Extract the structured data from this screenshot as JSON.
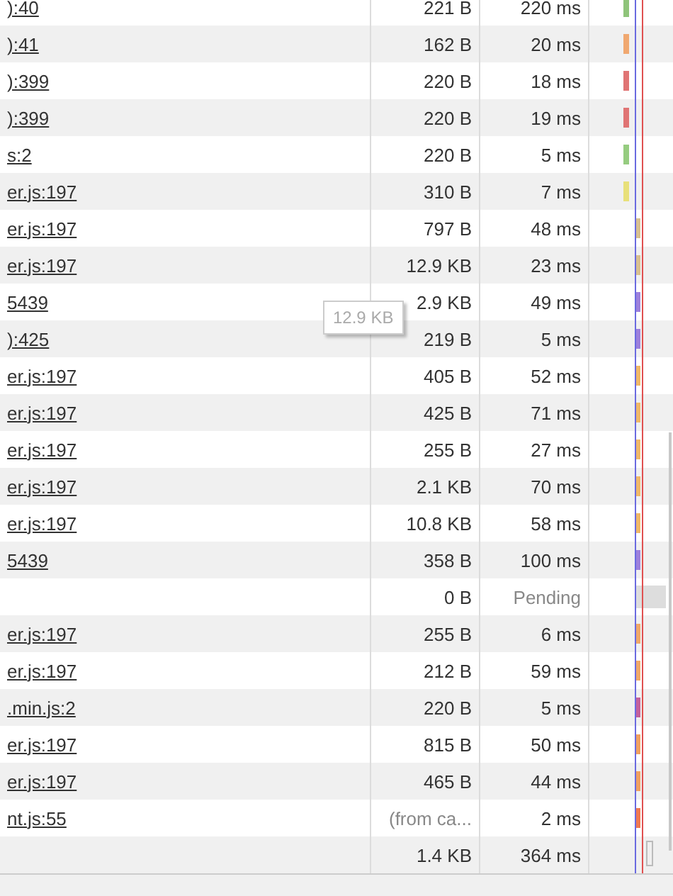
{
  "requests": [
    {
      "initiator": "):40",
      "size": "221 B",
      "time": "220 ms",
      "bar": {
        "kind": "early",
        "color": "#8fc47a"
      }
    },
    {
      "initiator": "):41",
      "size": "162 B",
      "time": "20 ms",
      "bar": {
        "kind": "early",
        "color": "#f0a870"
      }
    },
    {
      "initiator": "):399",
      "size": "220 B",
      "time": "18 ms",
      "bar": {
        "kind": "early",
        "color": "#e07474"
      }
    },
    {
      "initiator": "):399",
      "size": "220 B",
      "time": "19 ms",
      "bar": {
        "kind": "early",
        "color": "#e07474"
      }
    },
    {
      "initiator": "s:2",
      "size": "220 B",
      "time": "5 ms",
      "bar": {
        "kind": "early",
        "color": "#96cc80"
      }
    },
    {
      "initiator": "er.js:197",
      "size": "310 B",
      "time": "7 ms",
      "bar": {
        "kind": "early",
        "color": "#e8e07a"
      }
    },
    {
      "initiator": "er.js:197",
      "size": "797 B",
      "time": "48 ms",
      "bar": {
        "kind": "late",
        "color": "#d8c090"
      }
    },
    {
      "initiator": "er.js:197",
      "size": "12.9 KB",
      "time": "23 ms",
      "bar": {
        "kind": "late",
        "color": "#d8c090"
      }
    },
    {
      "initiator": "5439",
      "size": "2.9 KB",
      "time": "49 ms",
      "bar": {
        "kind": "late",
        "color": "#9c80dc"
      }
    },
    {
      "initiator": "):425",
      "size": "219 B",
      "time": "5 ms",
      "bar": {
        "kind": "late",
        "color": "#9c80dc"
      }
    },
    {
      "initiator": "er.js:197",
      "size": "405 B",
      "time": "52 ms",
      "bar": {
        "kind": "late",
        "color": "#f0b868"
      }
    },
    {
      "initiator": "er.js:197",
      "size": "425 B",
      "time": "71 ms",
      "bar": {
        "kind": "late",
        "color": "#f0b868"
      }
    },
    {
      "initiator": "er.js:197",
      "size": "255 B",
      "time": "27 ms",
      "bar": {
        "kind": "late",
        "color": "#f0b868"
      }
    },
    {
      "initiator": "er.js:197",
      "size": "2.1 KB",
      "time": "70 ms",
      "bar": {
        "kind": "late",
        "color": "#f0b868"
      }
    },
    {
      "initiator": "er.js:197",
      "size": "10.8 KB",
      "time": "58 ms",
      "bar": {
        "kind": "late",
        "color": "#f0b868"
      }
    },
    {
      "initiator": "5439",
      "size": "358 B",
      "time": "100 ms",
      "bar": {
        "kind": "late",
        "color": "#9c80dc"
      }
    },
    {
      "size": "0 B",
      "time": "Pending",
      "bar": {
        "kind": "pending",
        "color": "#dddddd"
      }
    },
    {
      "initiator": "er.js:197",
      "size": "255 B",
      "time": "6 ms",
      "bar": {
        "kind": "late",
        "color": "#f0a868"
      }
    },
    {
      "initiator": "er.js:197",
      "size": "212 B",
      "time": "59 ms",
      "bar": {
        "kind": "late",
        "color": "#f0a868"
      }
    },
    {
      "initiator": ".min.js:2",
      "size": "220 B",
      "time": "5 ms",
      "bar": {
        "kind": "late",
        "color": "#c4609c"
      }
    },
    {
      "initiator": "er.js:197",
      "size": "815 B",
      "time": "50 ms",
      "bar": {
        "kind": "late",
        "color": "#f0a060"
      }
    },
    {
      "initiator": "er.js:197",
      "size": "465 B",
      "time": "44 ms",
      "bar": {
        "kind": "late",
        "color": "#f0a060"
      }
    },
    {
      "initiator": "nt.js:55",
      "size": "(from ca...",
      "time": "2 ms",
      "bar": {
        "kind": "late",
        "color": "#f07850"
      }
    },
    {
      "size": "1.4 KB",
      "time": "364 ms",
      "bar": {
        "kind": "outline",
        "color": "#bbbbbb"
      }
    }
  ],
  "tooltip": "12.9 KB"
}
